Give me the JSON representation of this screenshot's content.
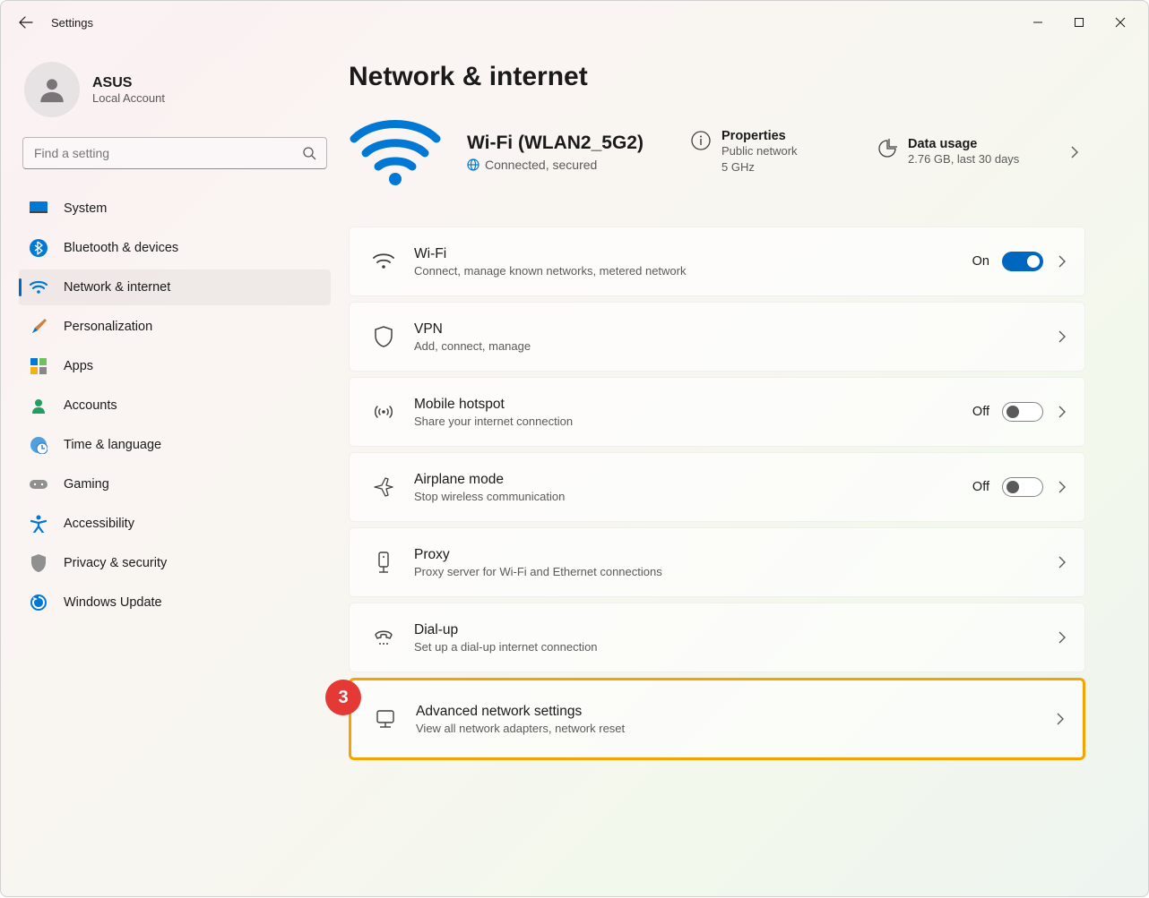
{
  "window": {
    "title": "Settings"
  },
  "profile": {
    "name": "ASUS",
    "subtitle": "Local Account"
  },
  "search": {
    "placeholder": "Find a setting"
  },
  "sidebar": {
    "items": [
      {
        "icon": "system",
        "label": "System"
      },
      {
        "icon": "bluetooth",
        "label": "Bluetooth & devices"
      },
      {
        "icon": "network",
        "label": "Network & internet",
        "active": true
      },
      {
        "icon": "personalization",
        "label": "Personalization"
      },
      {
        "icon": "apps",
        "label": "Apps"
      },
      {
        "icon": "accounts",
        "label": "Accounts"
      },
      {
        "icon": "time",
        "label": "Time & language"
      },
      {
        "icon": "gaming",
        "label": "Gaming"
      },
      {
        "icon": "accessibility",
        "label": "Accessibility"
      },
      {
        "icon": "privacy",
        "label": "Privacy & security"
      },
      {
        "icon": "update",
        "label": "Windows Update"
      }
    ]
  },
  "page": {
    "title": "Network & internet"
  },
  "status": {
    "network_name": "Wi-Fi (WLAN2_5G2)",
    "connection": "Connected, secured",
    "properties": {
      "title": "Properties",
      "line1": "Public network",
      "line2": "5 GHz"
    },
    "usage": {
      "title": "Data usage",
      "line1": "2.76 GB, last 30 days"
    }
  },
  "cards": {
    "wifi": {
      "title": "Wi-Fi",
      "subtitle": "Connect, manage known networks, metered network",
      "toggle_state": "On"
    },
    "vpn": {
      "title": "VPN",
      "subtitle": "Add, connect, manage"
    },
    "hotspot": {
      "title": "Mobile hotspot",
      "subtitle": "Share your internet connection",
      "toggle_state": "Off"
    },
    "airplane": {
      "title": "Airplane mode",
      "subtitle": "Stop wireless communication",
      "toggle_state": "Off"
    },
    "proxy": {
      "title": "Proxy",
      "subtitle": "Proxy server for Wi-Fi and Ethernet connections"
    },
    "dialup": {
      "title": "Dial-up",
      "subtitle": "Set up a dial-up internet connection"
    },
    "advanced": {
      "title": "Advanced network settings",
      "subtitle": "View all network adapters, network reset"
    }
  },
  "annotation": {
    "badge": "3"
  }
}
